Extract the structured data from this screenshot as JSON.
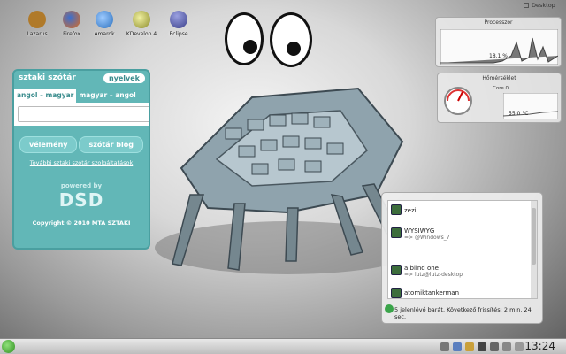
{
  "desktop": {
    "icons": [
      {
        "label": "Lazarus",
        "icon": "lazarus-icon",
        "color": "#b07a2a"
      },
      {
        "label": "Firefox",
        "icon": "firefox-icon",
        "color": "#e06a1a"
      },
      {
        "label": "Amarok",
        "icon": "amarok-icon",
        "color": "#2a6fbd"
      },
      {
        "label": "KDevelop 4",
        "icon": "kdevelop-icon",
        "color": "#b8b83a"
      },
      {
        "label": "Eclipse",
        "icon": "eclipse-icon",
        "color": "#3a3f8a"
      }
    ],
    "show_desktop_label": "Desktop"
  },
  "dictionary": {
    "title": "sztaki szótár",
    "languages_button": "nyelvek",
    "tab_active": "angol – magyar",
    "tab_inactive": "magyar – angol",
    "search_placeholder": "",
    "feedback_button": "vélemény",
    "blog_button": "szótár blog",
    "more_services_link": "További sztaki szótár szolgáltatások",
    "powered_by": "powered by",
    "brand": "DSD",
    "copyright": "Copyright © 2010 MTA SZTAKI"
  },
  "processor": {
    "title": "Processzor",
    "value": "18.1 %"
  },
  "temperature": {
    "title": "Hőmérséklet",
    "core_label": "Core 0",
    "value": "55.0 °C"
  },
  "messenger": {
    "contacts": [
      {
        "name": "zezi",
        "sub": ""
      },
      {
        "name": "WYSIWYG",
        "sub": "=> @Windows_7"
      },
      {
        "name": "a blind one",
        "sub": "=> lutz@lutz-desktop"
      },
      {
        "name": "atomiktankerman",
        "sub": ""
      }
    ],
    "status": "5 jelenlévő barát. Következő frissítés: 2 min. 24 sec."
  },
  "taskbar": {
    "clock": "13:24"
  }
}
